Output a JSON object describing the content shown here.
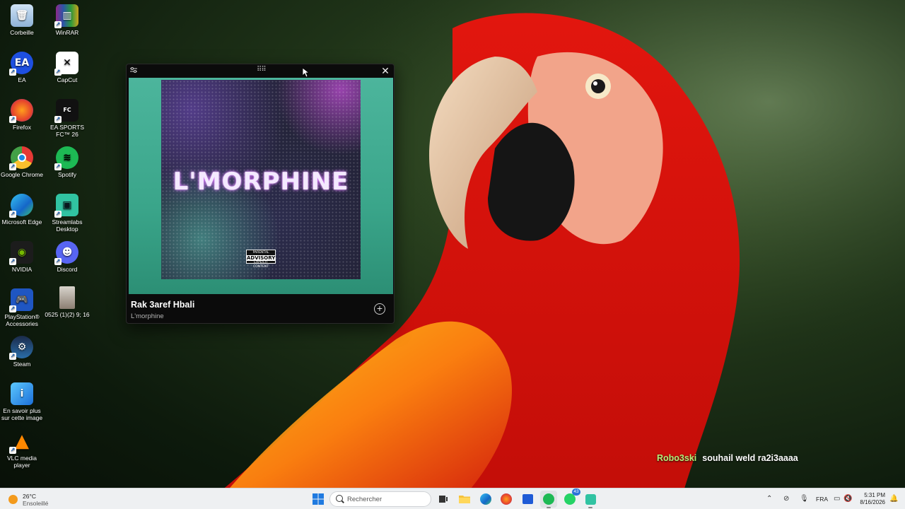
{
  "desktop": {
    "icons": [
      {
        "label": "Corbeille",
        "icon": "recycle-bin-icon"
      },
      {
        "label": "WinRAR",
        "icon": "winrar-icon"
      },
      {
        "label": "EA",
        "icon": "ea-icon"
      },
      {
        "label": "CapCut",
        "icon": "capcut-icon"
      },
      {
        "label": "Firefox",
        "icon": "firefox-icon"
      },
      {
        "label": "EA SPORTS FC™ 26",
        "icon": "ea-sports-fc-icon"
      },
      {
        "label": "Google Chrome",
        "icon": "chrome-icon"
      },
      {
        "label": "Spotify",
        "icon": "spotify-icon"
      },
      {
        "label": "Microsoft Edge",
        "icon": "edge-icon"
      },
      {
        "label": "Streamlabs Desktop",
        "icon": "streamlabs-icon"
      },
      {
        "label": "NVIDIA",
        "icon": "nvidia-icon"
      },
      {
        "label": "Discord",
        "icon": "discord-icon"
      },
      {
        "label": "PlayStation® Accessories",
        "icon": "playstation-icon"
      },
      {
        "label": "0525 (1)(2) 9; 16",
        "icon": "image-file-icon"
      },
      {
        "label": "Steam",
        "icon": "steam-icon"
      },
      {
        "label": "En savoir plus sur cette image",
        "icon": "info-icon"
      },
      {
        "label": "VLC media player",
        "icon": "vlc-icon"
      }
    ]
  },
  "player": {
    "cover_text": "L'MORPHINE",
    "advisory_top": "PARENTAL",
    "advisory_mid": "ADVISORY",
    "advisory_bot": "EXPLICIT CONTENT",
    "track_title": "Rak 3aref Hbali",
    "track_artist": "L'morphine",
    "close_glyph": "✕",
    "add_glyph": "+"
  },
  "chat": {
    "user": "Robo3ski",
    "message": "souhail weld ra2i3aaaa"
  },
  "taskbar": {
    "weather_temp": "26°C",
    "weather_cond": "Ensoleillé",
    "search_placeholder": "Rechercher",
    "whatsapp_badge": "43",
    "language": "FRA",
    "time": "5:31 PM",
    "date": "8/16/2026"
  },
  "colors": {
    "accent": "#1db954",
    "player_bg": "#0b0b0b",
    "art_bg": "#3aa58a",
    "chat_user": "#b6f07a"
  }
}
